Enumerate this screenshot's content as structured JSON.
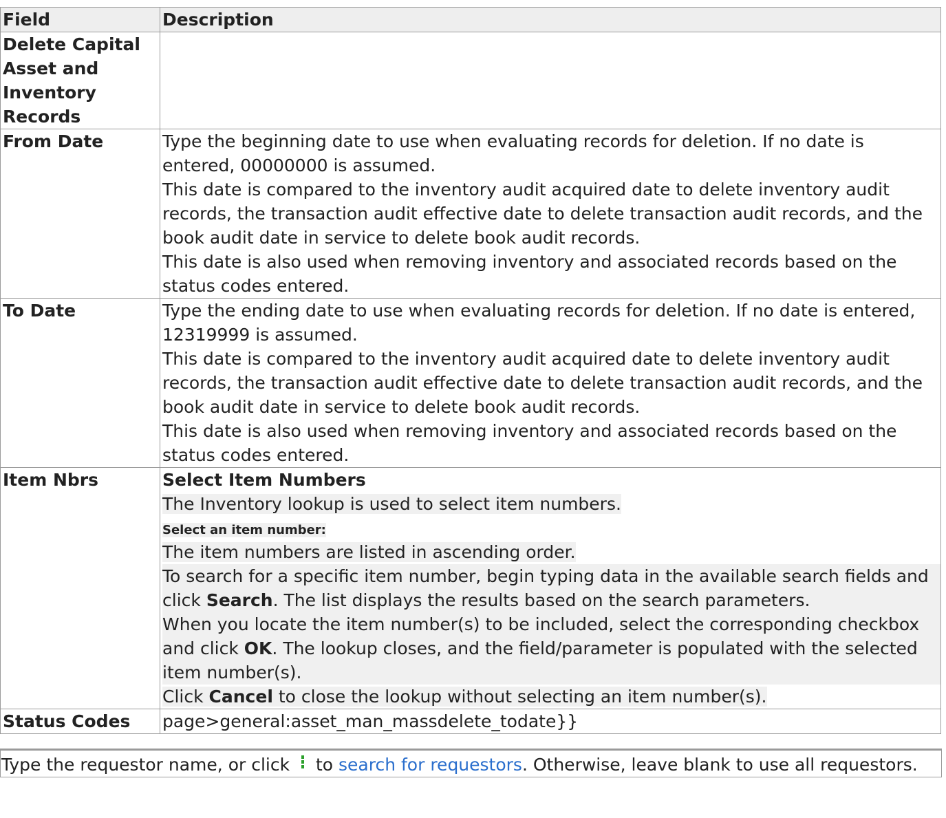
{
  "table": {
    "header": {
      "field": "Field",
      "description": "Description"
    },
    "section_title": "Delete Capital Asset and Inventory Records",
    "from_date": {
      "label": "From Date",
      "line1": "Type the beginning date to use when evaluating records for deletion. If no date is entered, 00000000 is assumed.",
      "line2": "This date is compared to the inventory audit acquired date to delete inventory audit records, the transaction audit effective date to delete transaction audit records, and the book audit date in service to delete book audit records.",
      "line3": "This date is also used when removing inventory and associated records based on the status codes entered."
    },
    "to_date": {
      "label": "To Date",
      "line1": "Type the ending date to use when evaluating records for deletion. If no date is entered, 12319999 is assumed.",
      "line2": "This date is compared to the inventory audit acquired date to delete inventory audit records, the transaction audit effective date to delete transaction audit records, and the book audit date in service to delete book audit records.",
      "line3": "This date is also used when removing inventory and associated records based on the status codes entered."
    },
    "item_nbrs": {
      "label": "Item Nbrs",
      "heading": "Select Item Numbers",
      "intro": "The Inventory lookup is used to select item numbers.",
      "subheading": "Select an item number:",
      "p1": "The item numbers are listed in ascending order.",
      "p2_a": "To search for a specific item number, begin typing data in the available search fields and click ",
      "p2_bold": "Search",
      "p2_b": ". The list displays the results based on the search parameters.",
      "p3_a": "When you locate the item number(s) to be included, select the corresponding checkbox and click ",
      "p3_bold": "OK",
      "p3_b": ". The lookup closes, and the field/parameter is populated with the selected item number(s).",
      "p4_a": "Click ",
      "p4_bold": "Cancel",
      "p4_b": " to close the lookup without selecting an item number(s)."
    },
    "status_codes": {
      "label": "Status Codes",
      "value": "page>general:asset_man_massdelete_todate}}"
    }
  },
  "footer": {
    "text_a": "Type the requestor name, or click ",
    "icon": "vertical-dots-icon",
    "text_b": " to ",
    "link": "search for requestors",
    "text_c": ". Otherwise, leave blank to use all requestors."
  }
}
